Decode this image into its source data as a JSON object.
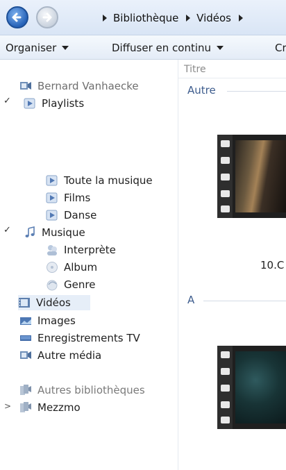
{
  "navigation": {
    "back_icon": "back-arrow-icon",
    "forward_icon": "forward-arrow-icon",
    "breadcrumb": [
      "Bibliothèque",
      "Vidéos"
    ]
  },
  "toolbar": {
    "organize_label": "Organiser",
    "stream_label": "Diffuser en continu",
    "cut_label": "Cr"
  },
  "sidebar": {
    "user_library": "Bernard Vanhaecke",
    "playlists": {
      "label": "Playlists",
      "items": [
        "Toute la musique",
        "Films",
        "Danse"
      ]
    },
    "music": {
      "label": "Musique",
      "items": [
        "Interprète",
        "Album",
        "Genre"
      ]
    },
    "videos": "Vidéos",
    "images": "Images",
    "tv": "Enregistrements TV",
    "other_media": "Autre média",
    "other_libraries": "Autres bibliothèques",
    "mezzmo": "Mezzmo"
  },
  "content": {
    "column_title": "Titre",
    "groups": [
      "Autre",
      "A"
    ],
    "item_caption": "10.C"
  },
  "colors": {
    "accent": "#2763b8",
    "group_text": "#3d5c8d",
    "selection": "#e6eef8"
  }
}
